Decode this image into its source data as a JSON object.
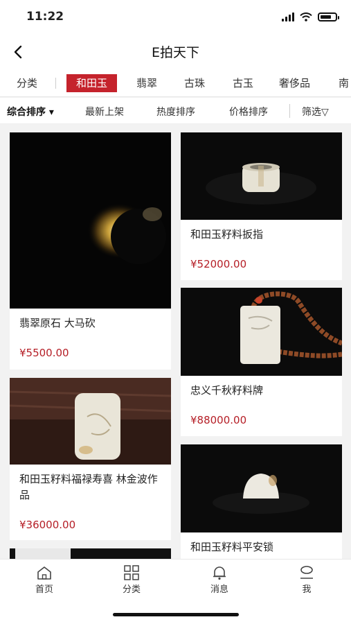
{
  "status": {
    "time": "11:22"
  },
  "nav": {
    "title": "E拍天下"
  },
  "categories": {
    "classify": "分类",
    "items": [
      "和田玉",
      "翡翠",
      "古珠",
      "古玉",
      "奢侈品",
      "南"
    ]
  },
  "sort": {
    "items": [
      "综合排序 ▾",
      "最新上架",
      "热度排序",
      "价格排序"
    ],
    "filter": "筛选▽"
  },
  "products": [
    {
      "title": "翡翠原石 大马砍",
      "price": "¥5500.00"
    },
    {
      "title": "和田玉籽料扳指",
      "price": "¥52000.00"
    },
    {
      "title": "忠义千秋籽料牌",
      "price": "¥88000.00"
    },
    {
      "title": "和田玉籽料福禄寿喜 林金波作品",
      "price": "¥36000.00"
    },
    {
      "title": "和田玉籽料平安锁",
      "price": ""
    }
  ],
  "tabbar": {
    "items": [
      "首页",
      "分类",
      "消息",
      "我"
    ]
  },
  "colors": {
    "accent": "#c5232c",
    "price": "#b51e26"
  }
}
